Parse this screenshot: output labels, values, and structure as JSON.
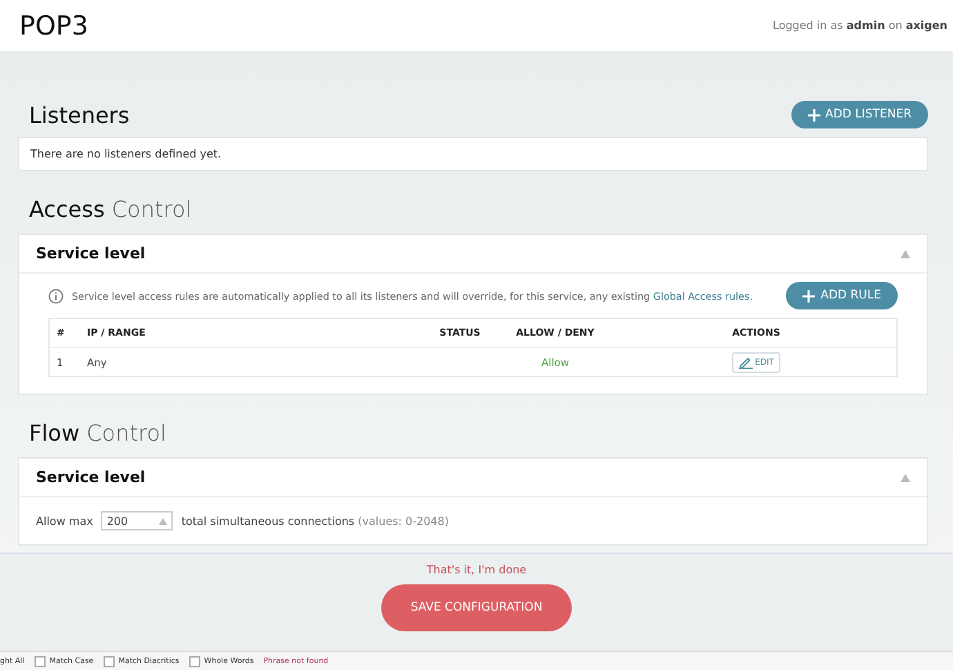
{
  "header": {
    "title": "POP3",
    "login": "Logged in as **admin** on **axigen**"
  },
  "listeners": {
    "title": "Listeners",
    "add_button": "ADD LISTENER",
    "empty": "There are no listeners defined yet."
  },
  "access_control": {
    "title_bold": "Access",
    "title_light": "Control",
    "panel": {
      "title": "Service level",
      "expanded": true,
      "info": "Service level access rules are automatically applied to all its listeners and will override, for this service, any existing",
      "link": "Global Access rules",
      "info_end": ".",
      "add_button": "ADD RULE",
      "columns": [
        "#",
        "IP / RANGE",
        "STATUS",
        "ALLOW / DENY",
        "ACTIONS"
      ],
      "rows": [
        {
          "index": "1",
          "range": "Any",
          "status": "",
          "allow": "Allow",
          "action": "EDIT"
        }
      ]
    }
  },
  "flow_control": {
    "title_bold": "Flow",
    "title_light": "Control",
    "panel": {
      "title": "Service level",
      "expanded": true,
      "label": "Allow max",
      "value": "200",
      "suffix": "total simultaneous connections",
      "hint": "(values: 0-2048)"
    }
  },
  "footer": {
    "note": "That's it, I'm done",
    "save_button": "SAVE CONFIGURATION"
  },
  "find_bar": {
    "cut_label": "ght All",
    "options": [
      {
        "label": "Match Case",
        "checked": false
      },
      {
        "label": "Match Diacritics",
        "checked": false
      },
      {
        "label": "Whole Words",
        "checked": false
      }
    ],
    "status": "Phrase not found"
  }
}
